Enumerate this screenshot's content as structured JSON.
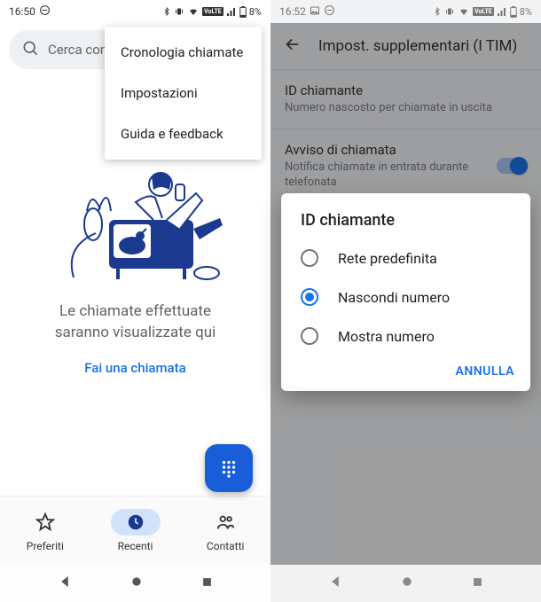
{
  "left": {
    "status": {
      "time": "16:50",
      "battery": "8%"
    },
    "search": {
      "placeholder": "Cerca cont"
    },
    "menu": {
      "items": [
        "Cronologia chiamate",
        "Impostazioni",
        "Guida e feedback"
      ]
    },
    "empty": {
      "line1": "Le chiamate effettuate",
      "line2": "saranno visualizzate qui",
      "cta": "Fai una chiamata"
    },
    "tabs": {
      "fav": "Preferiti",
      "recent": "Recenti",
      "contacts": "Contatti"
    }
  },
  "right": {
    "status": {
      "time": "16:52",
      "battery": "8%"
    },
    "appbar": {
      "title": "Impost. supplementari (I TIM)"
    },
    "settings": {
      "caller_id": {
        "title": "ID chiamante",
        "sub": "Numero nascosto per chiamate in uscita"
      },
      "call_waiting": {
        "title": "Avviso di chiamata",
        "sub": "Notifica chiamate in entrata durante telefonata"
      }
    },
    "dialog": {
      "title": "ID chiamante",
      "options": [
        "Rete predefinita",
        "Nascondi numero",
        "Mostra numero"
      ],
      "selected_index": 1,
      "cancel": "ANNULLA"
    }
  }
}
